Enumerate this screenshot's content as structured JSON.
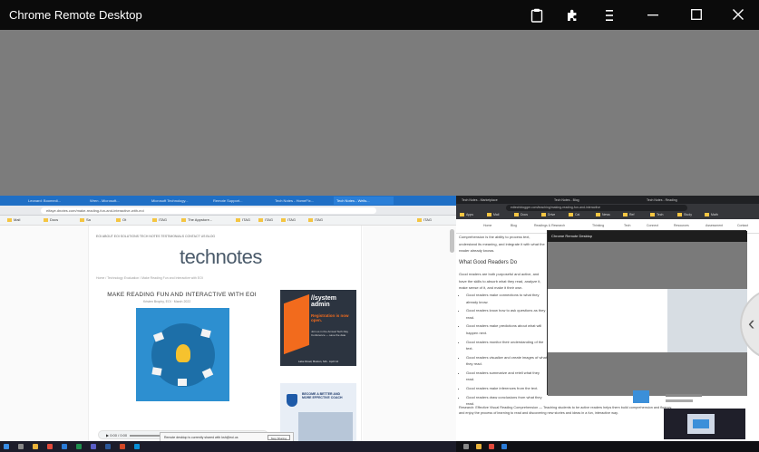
{
  "window": {
    "title": "Chrome Remote Desktop",
    "icons": [
      "clipboard-icon",
      "extension-icon",
      "menu-icon"
    ],
    "controls": {
      "minimize": "—",
      "maximize": "☐",
      "close": "✕"
    }
  },
  "left_screen": {
    "tabs": [
      "Leonard: Boomedi...",
      "Wren - Microsoft...",
      "Microsoft Technology...",
      "Remote Support...",
      "Tech Notes - HomeFix...",
      "Tech Notes - Wells..."
    ],
    "url": "eifaye.dnotes.com/make-reading-fun-and-interactive-with-eoi",
    "bookmarks": [
      "Mail",
      "Docs",
      "Sa",
      "Ot",
      "ITAG",
      "The Appstore...",
      "ITAG",
      "ITAG",
      "ITAG",
      "ITAG",
      "ITAG"
    ],
    "site": {
      "nav": "EOI    ABOUT    EOI SOLUTIONS    TECH NOTES    TESTIMONIALS    CONTACT US    BLOG",
      "logo": "technotes",
      "breadcrumb": "Home  /  Technology Evaluation  /  Make Reading Fun and Interactive with EOI",
      "article_title": "MAKE READING FUN AND INTERACTIVE WITH EOI",
      "byline": "Kristen Brophy, EOI  ·  March 2022"
    },
    "ad1": {
      "line1": "//system",
      "line2": "admin",
      "cta": "Registration is now open.",
      "details": "Join us in the Annual Tech Day Conference — save the date",
      "footer": "Lake Road, Boston, MA  ·  April 14"
    },
    "ad2": {
      "title": "BECOME A BETTER AND MORE EFFECTIVE COACH"
    },
    "audio": {
      "time": "0:00 / 0:00"
    },
    "toast": {
      "text": "Remote desktop is currently shared with ksh@eoi.us",
      "button": "Stop Sharing"
    }
  },
  "right_screen": {
    "url": "edtechblogger.com/teaching/making-reading-fun-and-interactive",
    "tabs": [
      "Tech Notes - Marketplace",
      "Tech Notes - Blog",
      "Tech Notes - Reading"
    ],
    "bookmarks": [
      "Apps",
      "Mail",
      "Docs",
      "Drive",
      "Cal",
      "News",
      "Ref",
      "Tech",
      "Study",
      "Math"
    ],
    "nav": [
      "Home",
      "Blog",
      "Readings & Research",
      "Thinking",
      "Tech",
      "Connect",
      "Resources",
      "Assessment",
      "Contact"
    ],
    "intro": "Comprehension is the ability to process text, understand its meaning, and integrate it with what the reader already knows.",
    "heading": "What Good Readers Do",
    "para": "Good readers are both purposeful and active, and have the skills to absorb what they read, analyze it, make sense of it, and make it their own.",
    "bullets": [
      "Good readers make connections to what they already know.",
      "Good readers know how to ask questions as they read.",
      "Good readers make predictions about what will happen next.",
      "Good readers monitor their understanding of the text.",
      "Good readers visualize and create images of what they read.",
      "Good readers summarize and retell what they read.",
      "Good readers make inferences from the text.",
      "Good readers draw conclusions from what they read."
    ],
    "footer_text": "Research: Effective Visual Reading Comprehension — Teaching students to be active readers helps them build comprehension and fluency, and enjoy the process of learning to read and discovering new stories and ideas in a fun, interactive way."
  }
}
